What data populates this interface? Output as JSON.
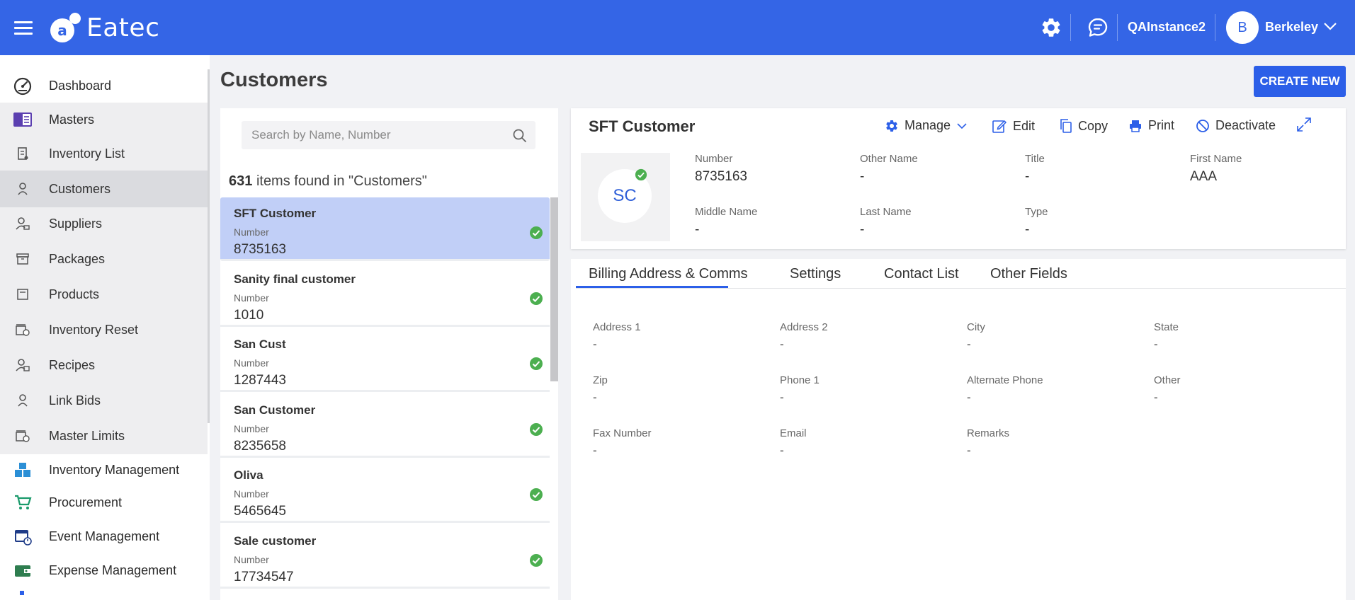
{
  "header": {
    "app_name": "Eatec",
    "instance": "QAInstance2",
    "user_initial": "B",
    "user_name": "Berkeley"
  },
  "sidebar": {
    "items": [
      {
        "label": "Dashboard",
        "icon": "gauge-icon"
      },
      {
        "label": "Masters",
        "icon": "book-icon"
      },
      {
        "label": "Inventory List",
        "icon": "clipboard-icon"
      },
      {
        "label": "Customers",
        "icon": "person-icon"
      },
      {
        "label": "Suppliers",
        "icon": "supplier-icon"
      },
      {
        "label": "Packages",
        "icon": "package-icon"
      },
      {
        "label": "Products",
        "icon": "product-icon"
      },
      {
        "label": "Inventory Reset",
        "icon": "reset-icon"
      },
      {
        "label": "Recipes",
        "icon": "chef-icon"
      },
      {
        "label": "Link Bids",
        "icon": "link-icon"
      },
      {
        "label": "Master Limits",
        "icon": "limits-icon"
      },
      {
        "label": "Inventory Management",
        "icon": "boxes-icon"
      },
      {
        "label": "Procurement",
        "icon": "cart-icon"
      },
      {
        "label": "Event Management",
        "icon": "calendar-icon"
      },
      {
        "label": "Expense Management",
        "icon": "wallet-icon"
      }
    ]
  },
  "page": {
    "title": "Customers",
    "create_label": "CREATE NEW"
  },
  "list": {
    "search_placeholder": "Search by Name, Number",
    "found_count": "631",
    "found_text": "items found in \"Customers\"",
    "items": [
      {
        "name": "SFT Customer",
        "number_label": "Number",
        "number": "8735163"
      },
      {
        "name": "Sanity final customer",
        "number_label": "Number",
        "number": "1010"
      },
      {
        "name": "San Cust",
        "number_label": "Number",
        "number": "1287443"
      },
      {
        "name": "San Customer",
        "number_label": "Number",
        "number": "8235658"
      },
      {
        "name": "Oliva",
        "number_label": "Number",
        "number": "5465645"
      },
      {
        "name": "Sale customer",
        "number_label": "Number",
        "number": "17734547"
      }
    ]
  },
  "detail": {
    "title": "SFT Customer",
    "actions": {
      "manage": "Manage",
      "edit": "Edit",
      "copy": "Copy",
      "print": "Print",
      "deactivate": "Deactivate"
    },
    "avatar_initials": "SC",
    "fields": [
      {
        "label": "Number",
        "value": "8735163"
      },
      {
        "label": "Other Name",
        "value": "-"
      },
      {
        "label": "Title",
        "value": "-"
      },
      {
        "label": "First Name",
        "value": "AAA"
      },
      {
        "label": "Middle Name",
        "value": "-"
      },
      {
        "label": "Last Name",
        "value": "-"
      },
      {
        "label": "Type",
        "value": "-"
      }
    ]
  },
  "tabs": {
    "items": [
      "Billing Address & Comms",
      "Settings",
      "Contact List",
      "Other Fields"
    ],
    "active": "Billing Address & Comms"
  },
  "billing": {
    "fields": [
      {
        "label": "Address 1",
        "value": "-"
      },
      {
        "label": "Address 2",
        "value": "-"
      },
      {
        "label": "City",
        "value": "-"
      },
      {
        "label": "State",
        "value": "-"
      },
      {
        "label": "Zip",
        "value": "-"
      },
      {
        "label": "Phone 1",
        "value": "-"
      },
      {
        "label": "Alternate Phone",
        "value": "-"
      },
      {
        "label": "Other",
        "value": "-"
      },
      {
        "label": "Fax Number",
        "value": "-"
      },
      {
        "label": "Email",
        "value": "-"
      },
      {
        "label": "Remarks",
        "value": "-"
      }
    ]
  },
  "colors": {
    "brand": "#3465e6",
    "primary_button": "#2c5fe8",
    "selected_row": "#c1cff7",
    "status_active": "#4caf50"
  }
}
